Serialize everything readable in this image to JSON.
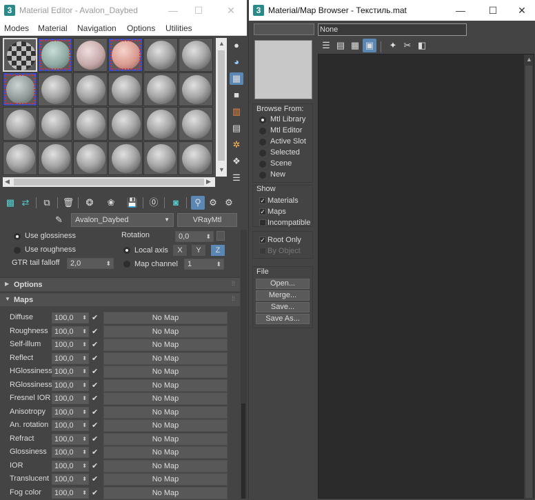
{
  "material_editor": {
    "app_icon": "3",
    "title": "Material Editor - Avalon_Daybed",
    "window_buttons": [
      "—",
      "☐",
      "✕"
    ],
    "menu": [
      "Modes",
      "Material",
      "Navigation",
      "Options",
      "Utilities"
    ],
    "material_name": "Avalon_Daybed",
    "material_type": "VRayMtl",
    "params": {
      "use_glossiness": "Use glossiness",
      "use_roughness": "Use roughness",
      "gtr_tail_falloff": "GTR tail falloff",
      "gtr_value": "2,0",
      "rotation": "Rotation",
      "rotation_value": "0,0",
      "local_axis": "Local axis",
      "axis_x": "X",
      "axis_y": "Y",
      "axis_z": "Z",
      "map_channel": "Map channel",
      "map_channel_value": "1"
    },
    "rollouts": {
      "options": "Options",
      "maps": "Maps"
    },
    "maps": [
      {
        "name": "Diffuse",
        "value": "100,0",
        "map": "No Map"
      },
      {
        "name": "Roughness",
        "value": "100,0",
        "map": "No Map"
      },
      {
        "name": "Self-illum",
        "value": "100,0",
        "map": "No Map"
      },
      {
        "name": "Reflect",
        "value": "100,0",
        "map": "No Map"
      },
      {
        "name": "HGlossiness",
        "value": "100,0",
        "map": "No Map"
      },
      {
        "name": "RGlossiness",
        "value": "100,0",
        "map": "No Map"
      },
      {
        "name": "Fresnel IOR",
        "value": "100,0",
        "map": "No Map"
      },
      {
        "name": "Anisotropy",
        "value": "100,0",
        "map": "No Map"
      },
      {
        "name": "An. rotation",
        "value": "100,0",
        "map": "No Map"
      },
      {
        "name": "Refract",
        "value": "100,0",
        "map": "No Map"
      },
      {
        "name": "Glossiness",
        "value": "100,0",
        "map": "No Map"
      },
      {
        "name": "IOR",
        "value": "100,0",
        "map": "No Map"
      },
      {
        "name": "Translucent",
        "value": "100,0",
        "map": "No Map"
      },
      {
        "name": "Fog color",
        "value": "100,0",
        "map": "No Map"
      }
    ]
  },
  "map_browser": {
    "app_icon": "3",
    "title": "Material/Map Browser - Текстиль.mat",
    "window_buttons": [
      "—",
      "☐",
      "✕"
    ],
    "name_field": "None",
    "browse_from": {
      "heading": "Browse From:",
      "options": [
        "Mtl Library",
        "Mtl Editor",
        "Active Slot",
        "Selected",
        "Scene",
        "New"
      ],
      "selected": "Mtl Library"
    },
    "show": {
      "heading": "Show",
      "materials": "Materials",
      "maps": "Maps",
      "incompatible": "Incompatible"
    },
    "root_only": "Root Only",
    "by_object": "By Object",
    "file": {
      "heading": "File",
      "open": "Open...",
      "merge": "Merge...",
      "save": "Save...",
      "save_as": "Save As..."
    }
  }
}
